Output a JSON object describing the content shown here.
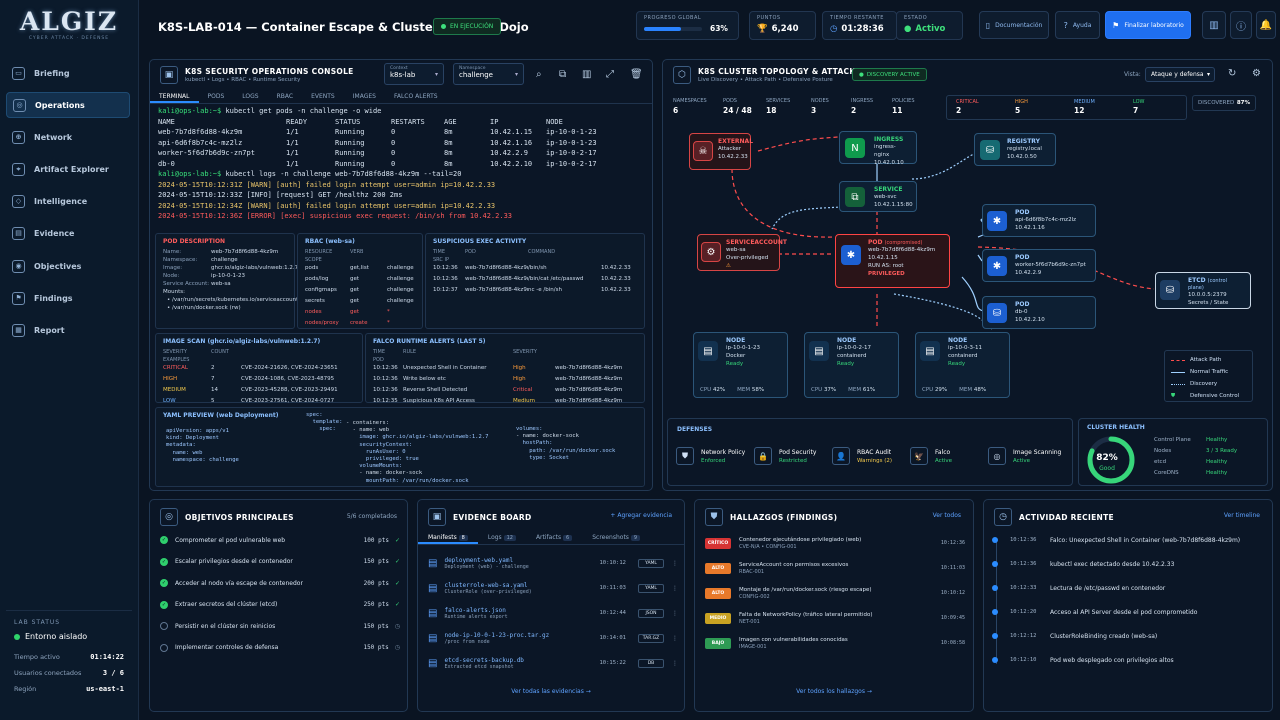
{
  "app": {
    "logo": "ALGIZ",
    "logo_sub": "CYBER ATTACK · DEFENSE",
    "title": "K8S-LAB-014 — Container Escape & Cluster Defense Dojo",
    "run_status": "EN EJECUCIÓN"
  },
  "header": {
    "progress_label": "PROGRESO GLOBAL",
    "progress_value": "63%",
    "progress": 0.63,
    "points_label": "PUNTOS",
    "points_value": "6,240",
    "time_label": "TIEMPO RESTANTE",
    "time_value": "01:28:36",
    "state_label": "ESTADO",
    "state_value": "Activo",
    "doc_label": "Documentación",
    "help_label": "Ayuda",
    "finish_label": "Finalizar laboratorio"
  },
  "nav": [
    "Briefing",
    "Operations",
    "Network",
    "Artifact Explorer",
    "Intelligence",
    "Evidence",
    "Objectives",
    "Findings",
    "Report"
  ],
  "lab_status": {
    "heading": "LAB STATUS",
    "env": "Entorno aislado",
    "rows": [
      {
        "k": "Tiempo activo",
        "v": "01:14:22"
      },
      {
        "k": "Usuarios conectados",
        "v": "3 / 6"
      },
      {
        "k": "Región",
        "v": "us-east-1"
      }
    ]
  },
  "console": {
    "title": "K8S SECURITY OPERATIONS CONSOLE",
    "sub": "kubectl • Logs • RBAC • Runtime Security",
    "ctx_label": "Context",
    "ctx_value": "k8s-lab",
    "ns_label": "Namespace",
    "ns_value": "challenge",
    "tabs": [
      "TERMINAL",
      "PODS",
      "LOGS",
      "RBAC",
      "EVENTS",
      "IMAGES",
      "FALCO ALERTS"
    ],
    "prompt1": "kali@ops-lab:~$",
    "cmd1": "kubectl get pods -n challenge -o wide",
    "pod_header": [
      "NAME",
      "READY",
      "STATUS",
      "RESTARTS",
      "AGE",
      "IP",
      "NODE"
    ],
    "pods": [
      [
        "web-7b7d8f6d88-4kz9m",
        "1/1",
        "Running",
        "0",
        "8m",
        "10.42.1.15",
        "ip-10-0-1-23"
      ],
      [
        "api-6d6f8b7c4c-mz2lz",
        "1/1",
        "Running",
        "0",
        "8m",
        "10.42.1.16",
        "ip-10-0-1-23"
      ],
      [
        "worker-5f6d7b6d9c-zn7pt",
        "1/1",
        "Running",
        "0",
        "8m",
        "10.42.2.9",
        "ip-10-0-2-17"
      ],
      [
        "db-0",
        "1/1",
        "Running",
        "0",
        "8m",
        "10.42.2.10",
        "ip-10-0-2-17"
      ]
    ],
    "prompt2": "kali@ops-lab:~$",
    "cmd2": "kubectl logs -n challenge web-7b7d8f6d88-4kz9m --tail=20",
    "logs": [
      {
        "t": "2024-05-15T10:12:31Z [WARN] [auth] failed login attempt user=admin  ip=10.42.2.33",
        "c": "warn"
      },
      {
        "t": "2024-05-15T10:12:33Z [INFO] [request] GET /healthz  200  2ms",
        "c": ""
      },
      {
        "t": "2024-05-15T10:12:34Z [WARN] [auth] failed login attempt user=admin  ip=10.42.2.33",
        "c": "warn"
      },
      {
        "t": "2024-05-15T10:12:36Z [ERROR] [exec] suspicious exec request: /bin/sh from 10.42.2.33",
        "c": "err"
      }
    ],
    "pod_desc": {
      "title": "POD DESCRIPTION",
      "rows": [
        [
          "Name:",
          "web-7b7d8f6d88-4kz9m"
        ],
        [
          "Namespace:",
          "challenge"
        ],
        [
          "Image:",
          "ghcr.io/algiz-labs/vulnweb:1.2.7"
        ],
        [
          "Node:",
          "ip-10-0-1-23"
        ],
        [
          "Service Account:",
          "web-sa"
        ]
      ],
      "mounts_label": "Mounts:",
      "mounts": [
        "/var/run/secrets/kubernetes.io/serviceaccount",
        "/var/run/docker.sock (rw)"
      ]
    },
    "rbac": {
      "title": "RBAC (web-sa)",
      "head": [
        "RESOURCE",
        "VERB",
        "SCOPE"
      ],
      "rows": [
        [
          "pods",
          "get,list",
          "challenge",
          ""
        ],
        [
          "pods/log",
          "get",
          "challenge",
          ""
        ],
        [
          "configmaps",
          "get",
          "challenge",
          ""
        ],
        [
          "secrets",
          "get",
          "challenge",
          ""
        ],
        [
          "nodes",
          "get",
          "*",
          "red"
        ],
        [
          "nodes/proxy",
          "create",
          "*",
          "red"
        ]
      ]
    },
    "exec": {
      "title": "SUSPICIOUS EXEC ACTIVITY",
      "head": [
        "TIME",
        "POD",
        "COMMAND",
        "SRC IP"
      ],
      "rows": [
        [
          "10:12:36",
          "web-7b7d8f6d88-4kz9m",
          "/bin/sh",
          "10.42.2.33"
        ],
        [
          "10:12:36",
          "web-7b7d8f6d88-4kz9m",
          "/bin/cat /etc/passwd",
          "10.42.2.33"
        ],
        [
          "10:12:37",
          "web-7b7d8f6d88-4kz9m",
          "nc -e /bin/sh",
          "10.42.2.33"
        ]
      ]
    },
    "scan": {
      "title": "IMAGE SCAN (ghcr.io/algiz-labs/vulnweb:1.2.7)",
      "head": [
        "SEVERITY",
        "COUNT",
        "EXAMPLES"
      ],
      "rows": [
        [
          "CRITICAL",
          "2",
          "CVE-2024-21626, CVE-2024-23651",
          "red"
        ],
        [
          "HIGH",
          "7",
          "CVE-2024-1086, CVE-2023-48795",
          "orange"
        ],
        [
          "MEDIUM",
          "14",
          "CVE-2023-45288, CVE-2023-29491",
          "yellow"
        ],
        [
          "LOW",
          "5",
          "CVE-2023-27561, CVE-2024-0727",
          "blue"
        ]
      ]
    },
    "falco": {
      "title": "FALCO RUNTIME ALERTS (LAST 5)",
      "head": [
        "TIME",
        "RULE",
        "SEVERITY",
        "POD"
      ],
      "rows": [
        [
          "10:12:36",
          "Unexpected Shell in Container",
          "High",
          "web-7b7d8f6d88-4kz9m",
          "orange"
        ],
        [
          "10:12:36",
          "Write below etc",
          "High",
          "web-7b7d8f6d88-4kz9m",
          "orange"
        ],
        [
          "10:12:36",
          "Reverse Shell Detected",
          "Critical",
          "web-7b7d8f6d88-4kz9m",
          "red"
        ],
        [
          "10:12:35",
          "Suspicious K8s API Access",
          "Medium",
          "web-7b7d8f6d88-4kz9m",
          "yellow"
        ],
        [
          "10:12:34",
          "Container Created in Privileged",
          "Medium",
          "web-7b7d8f6d88-4kz9m",
          "yellow"
        ]
      ]
    },
    "yaml": {
      "title": "YAML PREVIEW (web Deployment)",
      "col1": [
        "apiVersion: apps/v1",
        "kind: Deployment",
        "metadata:",
        "  name: web",
        "  namespace: challenge"
      ],
      "col2": [
        "spec:",
        "  template:",
        "    spec:"
      ],
      "col3": [
        "- containers:",
        "  - name: web",
        "    image: ghcr.io/algiz-labs/vulnweb:1.2.7",
        "    securityContext:",
        "      runAsUser: 0",
        "      privileged: true",
        "    volumeMounts:",
        "    - name: docker-sock",
        "      mountPath: /var/run/docker.sock"
      ],
      "col4": [
        "volumes:",
        "- name: docker-sock",
        "  hostPath:",
        "    path: /var/run/docker.sock",
        "    type: Socket"
      ]
    }
  },
  "topology": {
    "title": "K8S CLUSTER TOPOLOGY & ATTACK MAP",
    "sub": "Live Discovery • Attack Path • Defensive Posture",
    "badge": "DISCOVERY ACTIVE",
    "view_label": "Vista:",
    "view_value": "Ataque y defensa",
    "counts": [
      {
        "k": "NAMESPACES",
        "v": "6"
      },
      {
        "k": "PODS",
        "v": "24 / 48"
      },
      {
        "k": "SERVICES",
        "v": "18"
      },
      {
        "k": "NODES",
        "v": "3"
      },
      {
        "k": "INGRESS",
        "v": "2"
      },
      {
        "k": "POLICIES",
        "v": "11"
      }
    ],
    "sev": [
      {
        "k": "CRITICAL",
        "v": "2"
      },
      {
        "k": "HIGH",
        "v": "5"
      },
      {
        "k": "MEDIUM",
        "v": "12"
      },
      {
        "k": "LOW",
        "v": "7"
      }
    ],
    "discovered_label": "DISCOVERED",
    "discovered_value": "87%",
    "external": {
      "n": "EXTERNAL",
      "a": "Attacker",
      "b": "10.42.2.33"
    },
    "ingress": {
      "n": "INGRESS",
      "a": "ingress-nginx",
      "b": "10.42.0.10"
    },
    "registry": {
      "n": "REGISTRY",
      "a": "registry.local",
      "b": "10.42.0.50"
    },
    "service": {
      "n": "SERVICE",
      "a": "web-svc",
      "b": "10.42.1.15:80"
    },
    "sa": {
      "n": "SERVICEACCOUNT",
      "a": "web-sa",
      "b": "Over-privileged"
    },
    "pod_comp": {
      "n": "POD",
      "tag": "(compromised)",
      "a": "web-7b7d8f6d88-4kz9m",
      "b": "10.42.1.15",
      "c": "RUN AS: root",
      "d": "PRIVILEGED"
    },
    "pods": [
      {
        "n": "POD",
        "a": "api-6d6f8b7c4c-mz2lz",
        "b": "10.42.1.16"
      },
      {
        "n": "POD",
        "a": "worker-5f6d7b6d9c-zn7pt",
        "b": "10.42.2.9"
      },
      {
        "n": "POD",
        "a": "db-0",
        "b": "10.42.2.10"
      }
    ],
    "etcd": {
      "n": "ETCD",
      "tag": "(control plane)",
      "a": "10.0.0.5:2379",
      "b": "Secrets / State"
    },
    "nodes": [
      {
        "n": "NODE",
        "a": "ip-10-0-1-23",
        "b": "Docker",
        "s": "Ready",
        "cpu": "42%",
        "mem": "58%"
      },
      {
        "n": "NODE",
        "a": "ip-10-0-2-17",
        "b": "containerd",
        "s": "Ready",
        "cpu": "37%",
        "mem": "61%"
      },
      {
        "n": "NODE",
        "a": "ip-10-0-3-11",
        "b": "containerd",
        "s": "Ready",
        "cpu": "29%",
        "mem": "48%"
      }
    ],
    "cpu_label": "CPU",
    "mem_label": "MEM",
    "legend": [
      "Attack Path",
      "Normal Traffic",
      "Discovery",
      "Defensive Control"
    ],
    "defenses_title": "DEFENSES",
    "defenses": [
      {
        "n": "Network Policy",
        "s": "Enforced",
        "c": "green"
      },
      {
        "n": "Pod Security",
        "s": "Restricted",
        "c": "green"
      },
      {
        "n": "RBAC Audit",
        "s": "Warnings (2)",
        "c": "yellow"
      },
      {
        "n": "Falco",
        "s": "Active",
        "c": "green"
      },
      {
        "n": "Image Scanning",
        "s": "Active",
        "c": "green"
      }
    ],
    "health": {
      "title": "CLUSTER HEALTH",
      "value": "82%",
      "fraction": 0.82,
      "label": "Good",
      "rows": [
        {
          "k": "Control Plane",
          "v": "Healthy"
        },
        {
          "k": "Nodes",
          "v": "3 / 3 Ready"
        },
        {
          "k": "etcd",
          "v": "Healthy"
        },
        {
          "k": "CoreDNS",
          "v": "Healthy"
        }
      ]
    }
  },
  "objectives": {
    "title": "OBJETIVOS PRINCIPALES",
    "count": "5/6 completados",
    "items": [
      {
        "t": "Comprometer el pod vulnerable web",
        "p": "100 pts",
        "done": true
      },
      {
        "t": "Escalar privilegios desde el contenedor",
        "p": "150 pts",
        "done": true
      },
      {
        "t": "Acceder al nodo vía escape de contenedor",
        "p": "200 pts",
        "done": true
      },
      {
        "t": "Extraer secretos del clúster (etcd)",
        "p": "250 pts",
        "done": true
      },
      {
        "t": "Persistir en el clúster sin reinicios",
        "p": "150 pts",
        "done": false
      },
      {
        "t": "Implementar controles de defensa",
        "p": "150 pts",
        "done": false
      }
    ]
  },
  "evidence": {
    "title": "EVIDENCE BOARD",
    "add": "+ Agregar evidencia",
    "tabs": [
      {
        "n": "Manifests",
        "c": "8"
      },
      {
        "n": "Logs",
        "c": "12"
      },
      {
        "n": "Artifacts",
        "c": "6"
      },
      {
        "n": "Screenshots",
        "c": "9"
      }
    ],
    "items": [
      {
        "n": "deployment-web.yaml",
        "d": "Deployment (web) - challenge",
        "t": "10:10:12",
        "f": "YAML"
      },
      {
        "n": "clusterrole-web-sa.yaml",
        "d": "ClusterRole (over-privileged)",
        "t": "10:11:03",
        "f": "YAML"
      },
      {
        "n": "falco-alerts.json",
        "d": "Runtime alerts export",
        "t": "10:12:44",
        "f": "JSON"
      },
      {
        "n": "node-ip-10-0-1-23-proc.tar.gz",
        "d": "/proc from node",
        "t": "10:14:01",
        "f": "TAR.GZ"
      },
      {
        "n": "etcd-secrets-backup.db",
        "d": "Extracted etcd snapshot",
        "t": "10:15:22",
        "f": "DB"
      }
    ],
    "more": "Ver todas las evidencias →"
  },
  "findings": {
    "title": "HALLAZGOS (FINDINGS)",
    "all": "Ver todos",
    "items": [
      {
        "s": "CRÍTICO",
        "c": "#d63434",
        "t": "Contenedor ejecutándose privilegiado (web)",
        "id": "CVE-N/A • CONFIG-001",
        "time": "10:12:36"
      },
      {
        "s": "ALTO",
        "c": "#e8792a",
        "t": "ServiceAccount con permisos excesivos",
        "id": "RBAC-001",
        "time": "10:11:03"
      },
      {
        "s": "ALTO",
        "c": "#e8792a",
        "t": "Montaje de /var/run/docker.sock (riesgo escape)",
        "id": "CONFIG-002",
        "time": "10:10:12"
      },
      {
        "s": "MEDIO",
        "c": "#c9a222",
        "t": "Falta de NetworkPolicy (tráfico lateral permitido)",
        "id": "NET-001",
        "time": "10:09:45"
      },
      {
        "s": "BAJO",
        "c": "#2e9b54",
        "t": "Imagen con vulnerabilidades conocidas",
        "id": "IMAGE-001",
        "time": "10:08:58"
      }
    ],
    "more": "Ver todos los hallazgos →"
  },
  "activity": {
    "title": "ACTIVIDAD RECIENTE",
    "all": "Ver timeline",
    "items": [
      {
        "t": "10:12:36",
        "e": "Falco: Unexpected Shell in Container (web-7b7d8f6d88-4kz9m)"
      },
      {
        "t": "10:12:36",
        "e": "kubectl exec detectado desde 10.42.2.33"
      },
      {
        "t": "10:12:33",
        "e": "Lectura de /etc/passwd en contenedor"
      },
      {
        "t": "10:12:20",
        "e": "Acceso al API Server desde el pod comprometido"
      },
      {
        "t": "10:12:12",
        "e": "ClusterRoleBinding creado (web-sa)"
      },
      {
        "t": "10:12:10",
        "e": "Pod web desplegado con privilegios altos"
      }
    ]
  }
}
